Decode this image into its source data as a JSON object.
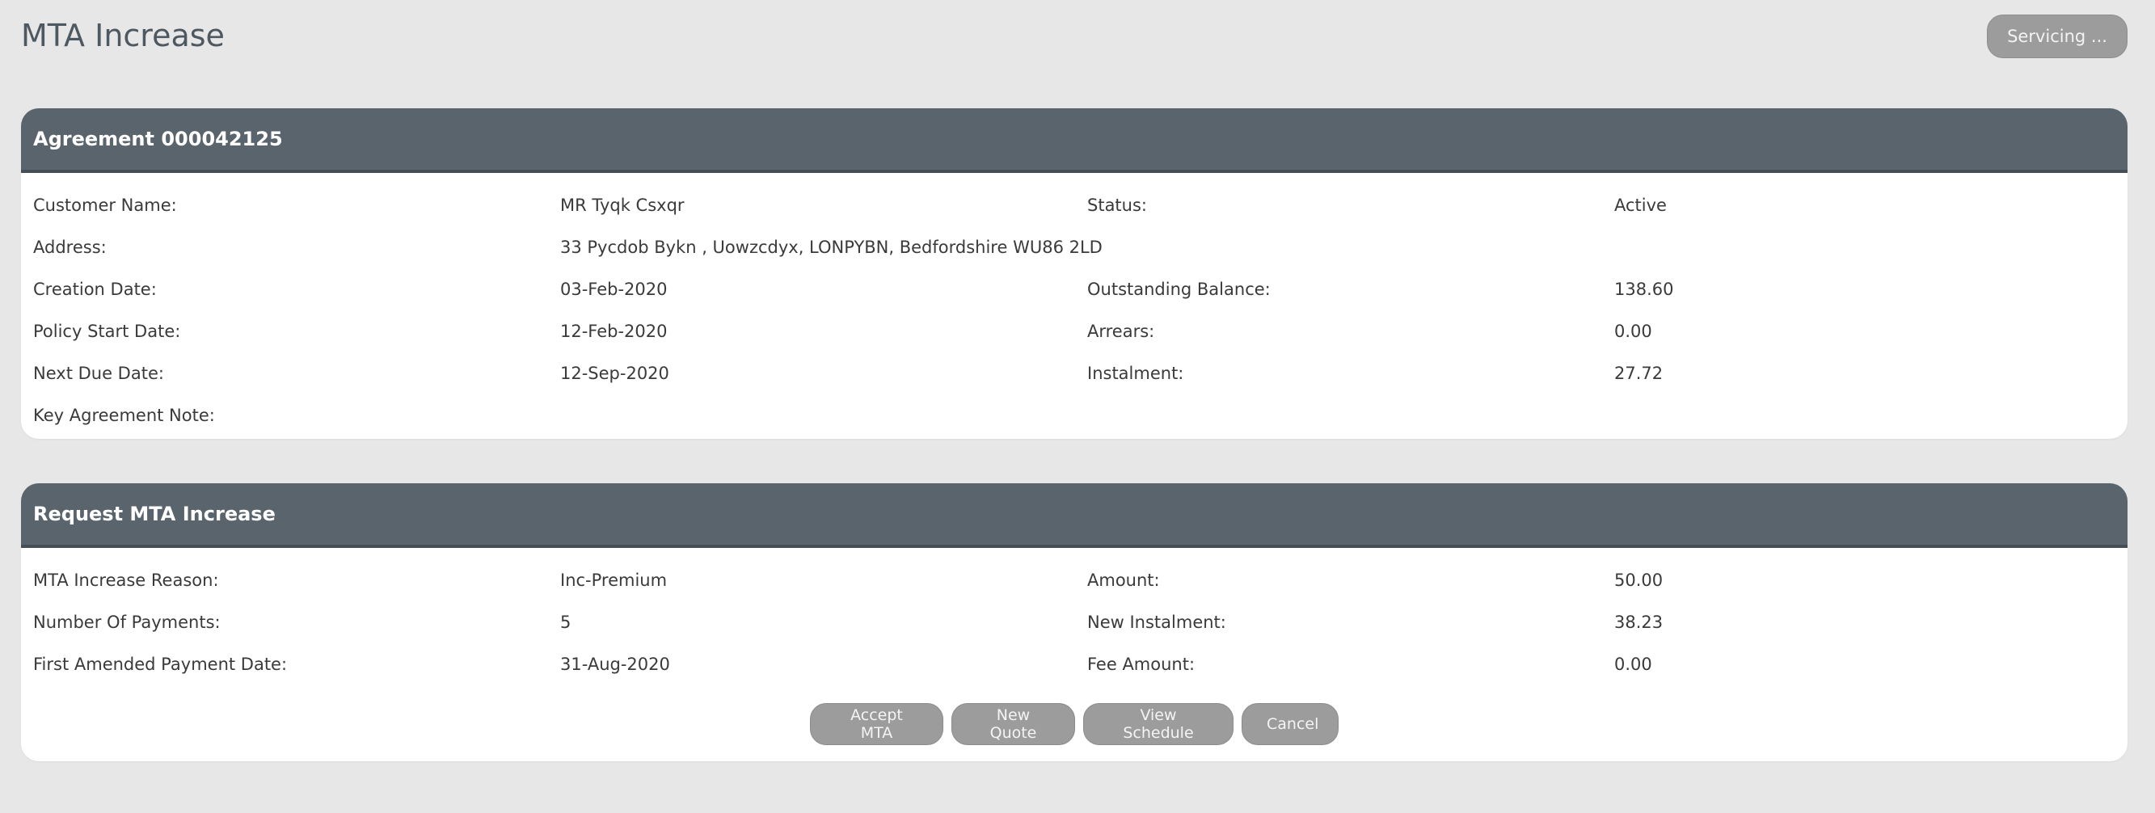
{
  "page": {
    "title": "MTA Increase",
    "servicing_label": "Servicing ..."
  },
  "agreement": {
    "header": "Agreement 000042125",
    "rows": [
      {
        "label1": "Customer Name:",
        "value1": "MR Tyqk Csxqr",
        "label2": "Status:",
        "value2": "Active"
      },
      {
        "label1": "Address:",
        "value1": "33 Pycdob Bykn , Uowzcdyx, LONPYBN, Bedfordshire WU86 2LD",
        "label2": "",
        "value2": ""
      },
      {
        "label1": "Creation Date:",
        "value1": "03-Feb-2020",
        "label2": "Outstanding Balance:",
        "value2": "138.60"
      },
      {
        "label1": "Policy Start Date:",
        "value1": "12-Feb-2020",
        "label2": "Arrears:",
        "value2": "0.00"
      },
      {
        "label1": "Next Due Date:",
        "value1": "12-Sep-2020",
        "label2": "Instalment:",
        "value2": "27.72"
      },
      {
        "label1": "Key Agreement Note:",
        "value1": "",
        "label2": "",
        "value2": ""
      }
    ]
  },
  "request": {
    "header": "Request MTA Increase",
    "rows": [
      {
        "label1": "MTA Increase Reason:",
        "value1": "Inc-Premium",
        "label2": "Amount:",
        "value2": "50.00"
      },
      {
        "label1": "Number Of Payments:",
        "value1": "5",
        "label2": "New Instalment:",
        "value2": "38.23"
      },
      {
        "label1": "First Amended Payment Date:",
        "value1": "31-Aug-2020",
        "label2": "Fee Amount:",
        "value2": "0.00"
      }
    ],
    "buttons": {
      "accept": "Accept MTA",
      "new_quote": "New Quote",
      "view_schedule": "View Schedule",
      "cancel": "Cancel"
    }
  },
  "colors": {
    "page_background": "#e7e7e7",
    "panel_header": "#5a646d",
    "button_grey": "#9c9c9c",
    "title_text": "#4e5860"
  }
}
